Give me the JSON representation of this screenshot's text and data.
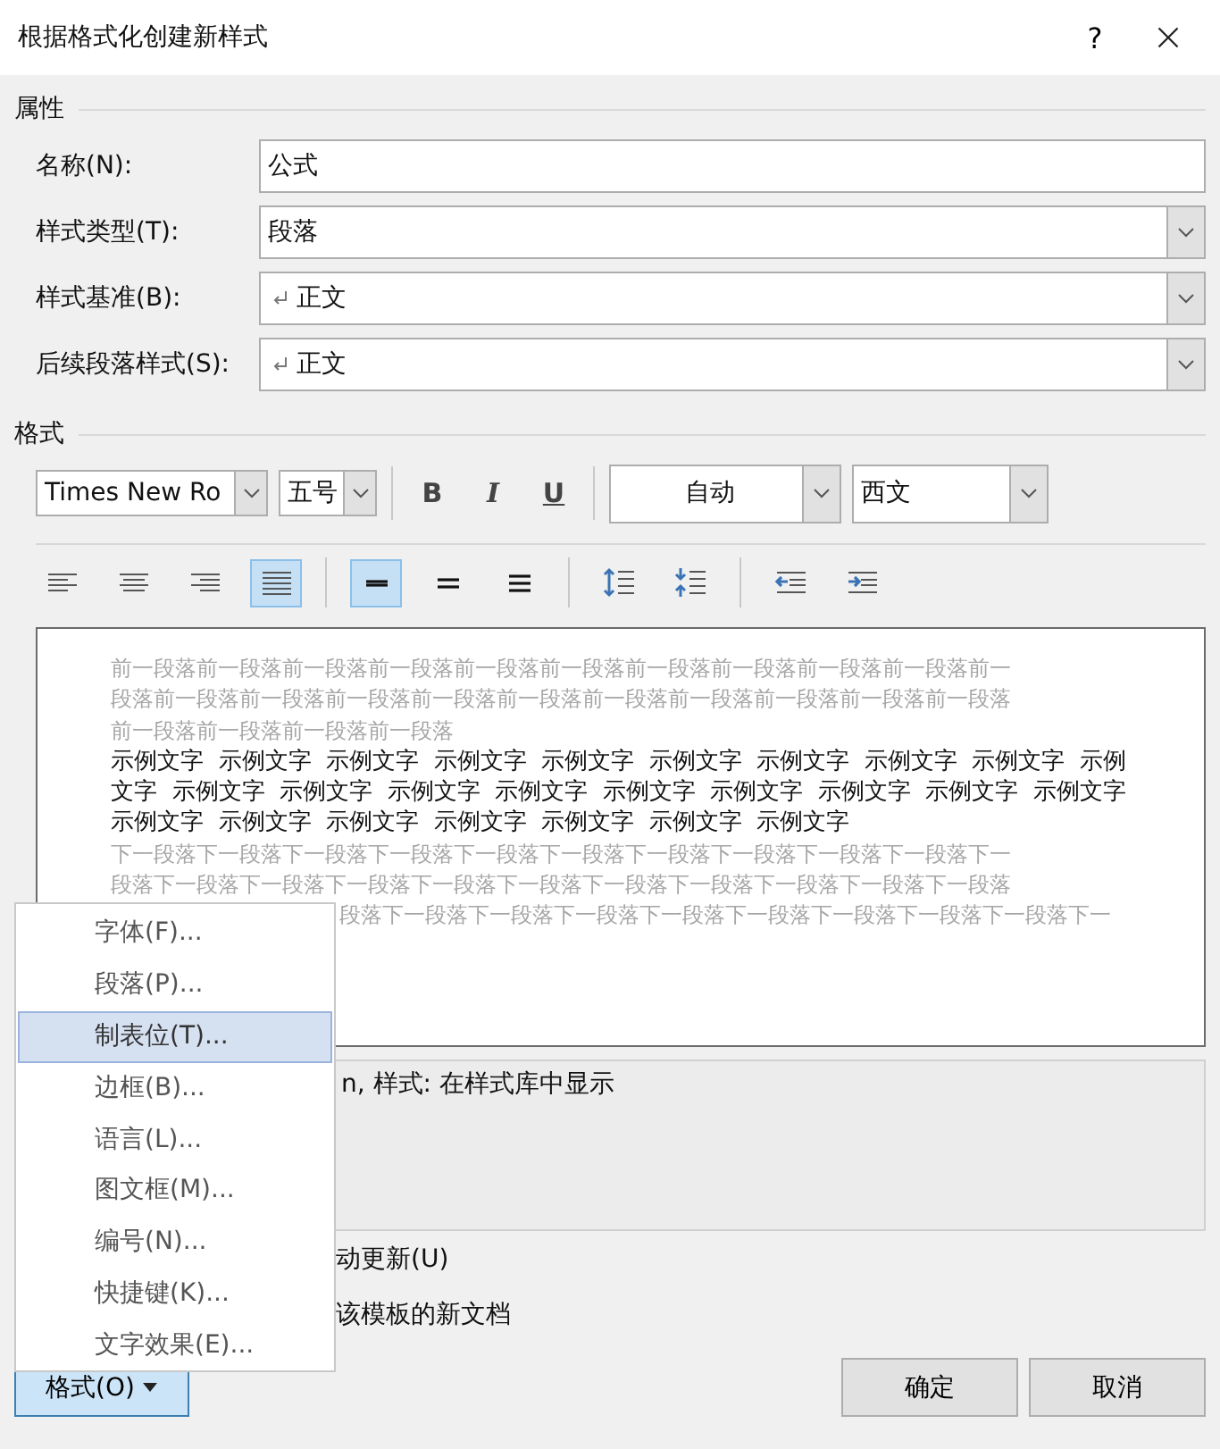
{
  "window": {
    "title": "根据格式化创建新样式",
    "help": "?"
  },
  "properties": {
    "heading": "属性",
    "fields": [
      {
        "label": "名称(N):",
        "value": "公式",
        "kind": "text"
      },
      {
        "label": "样式类型(T):",
        "value": "段落",
        "kind": "combo"
      },
      {
        "label": "样式基准(B):",
        "value": "正文",
        "kind": "para-combo"
      },
      {
        "label": "后续段落样式(S):",
        "value": "正文",
        "kind": "para-combo"
      }
    ]
  },
  "format": {
    "heading": "格式",
    "font": "Times New Ro",
    "size": "五号",
    "bold": "B",
    "italic": "I",
    "underline": "U",
    "color_choice": "自动",
    "script": "西文",
    "paragraph_tools": [
      {
        "kind": "align-left",
        "selected": false
      },
      {
        "kind": "align-center",
        "selected": false
      },
      {
        "kind": "align-right",
        "selected": false
      },
      {
        "kind": "justify",
        "selected": true
      },
      {
        "kind": "single",
        "selected": true
      },
      {
        "kind": "one-half",
        "selected": false
      },
      {
        "kind": "double",
        "selected": false
      },
      {
        "kind": "space-more",
        "selected": false
      },
      {
        "kind": "space-less",
        "selected": false
      },
      {
        "kind": "outdent",
        "selected": false
      },
      {
        "kind": "indent",
        "selected": false
      }
    ]
  },
  "preview": {
    "lines": [
      {
        "kind": "prev",
        "text": "前一段落前一段落前一段落前一段落前一段落前一段落前一段落前一段落前一段落前一段落前一"
      },
      {
        "kind": "prev",
        "text": "段落前一段落前一段落前一段落前一段落前一段落前一段落前一段落前一段落前一段落前一段落"
      },
      {
        "kind": "prev",
        "text": "前一段落前一段落前一段落前一段落"
      },
      {
        "kind": "sample",
        "text": "示例文字  示例文字  示例文字  示例文字  示例文字  示例文字  示例文字  示例文字  示例文字  示例"
      },
      {
        "kind": "sample",
        "text": "文字  示例文字  示例文字  示例文字  示例文字  示例文字  示例文字  示例文字  示例文字  示例文字"
      },
      {
        "kind": "sample",
        "text": "示例文字  示例文字  示例文字  示例文字  示例文字  示例文字  示例文字"
      },
      {
        "kind": "next",
        "text": "下一段落下一段落下一段落下一段落下一段落下一段落下一段落下一段落下一段落下一段落下一"
      },
      {
        "kind": "next",
        "text": "段落下一段落下一段落下一段落下一段落下一段落下一段落下一段落下一段落下一段落下一段落"
      },
      {
        "kind": "next-cut",
        "text": "段落下一段落下一段落下一段落下一段落下一段落下一段落下一段落下一段落下一"
      }
    ]
  },
  "description": "n, 样式: 在样式库中显示",
  "options": [
    "动更新(U)",
    "该模板的新文档"
  ],
  "format_menu": {
    "items": [
      {
        "label": "字体(F)...",
        "selected": false
      },
      {
        "label": "段落(P)...",
        "selected": false
      },
      {
        "label": "制表位(T)...",
        "selected": true
      },
      {
        "label": "边框(B)...",
        "selected": false
      },
      {
        "label": "语言(L)...",
        "selected": false
      },
      {
        "label": "图文框(M)...",
        "selected": false
      },
      {
        "label": "编号(N)...",
        "selected": false
      },
      {
        "label": "快捷键(K)...",
        "selected": false
      },
      {
        "label": "文字效果(E)...",
        "selected": false
      }
    ]
  },
  "buttons": {
    "format": "格式(O)",
    "ok": "确定",
    "cancel": "取消"
  }
}
